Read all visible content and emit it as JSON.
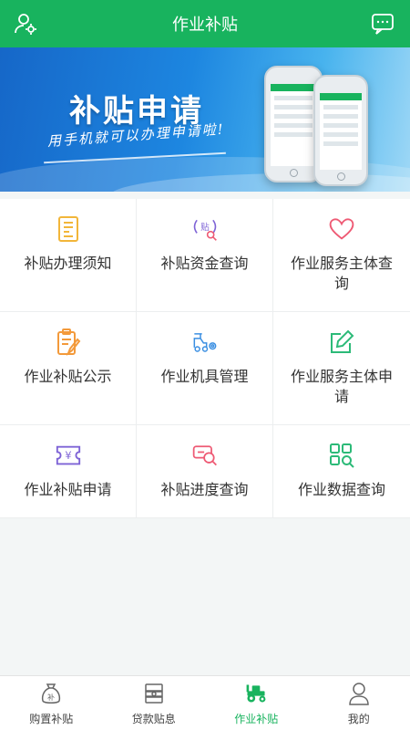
{
  "header": {
    "title": "作业补贴",
    "left_icon": "user-settings-icon",
    "right_icon": "message-icon"
  },
  "banner": {
    "title": "补贴申请",
    "subtitle": "用手机就可以办理申请啦!"
  },
  "grid": {
    "items": [
      {
        "label": "补贴办理须知",
        "icon": "notice-doc-icon",
        "color": "#f2b63a"
      },
      {
        "label": "补贴资金查询",
        "icon": "subsidy-search-icon",
        "color": "#7e63d6"
      },
      {
        "label": "作业服务主体查询",
        "icon": "heart-icon",
        "color": "#ee5a74"
      },
      {
        "label": "作业补贴公示",
        "icon": "clipboard-edit-icon",
        "color": "#f39a3b"
      },
      {
        "label": "作业机具管理",
        "icon": "forklift-gear-icon",
        "color": "#3b8fe2"
      },
      {
        "label": "作业服务主体申请",
        "icon": "edit-square-icon",
        "color": "#2cba78"
      },
      {
        "label": "作业补贴申请",
        "icon": "yen-ticket-icon",
        "color": "#7e63d6"
      },
      {
        "label": "补贴进度查询",
        "icon": "progress-search-icon",
        "color": "#ee5a74"
      },
      {
        "label": "作业数据查询",
        "icon": "data-grid-search-icon",
        "color": "#2cba78"
      }
    ]
  },
  "tabbar": {
    "items": [
      {
        "label": "购置补贴",
        "icon": "money-bag-icon",
        "active": false
      },
      {
        "label": "贷款贴息",
        "icon": "cash-stack-icon",
        "active": false
      },
      {
        "label": "作业补贴",
        "icon": "tractor-icon",
        "active": true
      },
      {
        "label": "我的",
        "icon": "person-icon",
        "active": false
      }
    ]
  },
  "colors": {
    "primary": "#18b35e",
    "text": "#333333"
  }
}
